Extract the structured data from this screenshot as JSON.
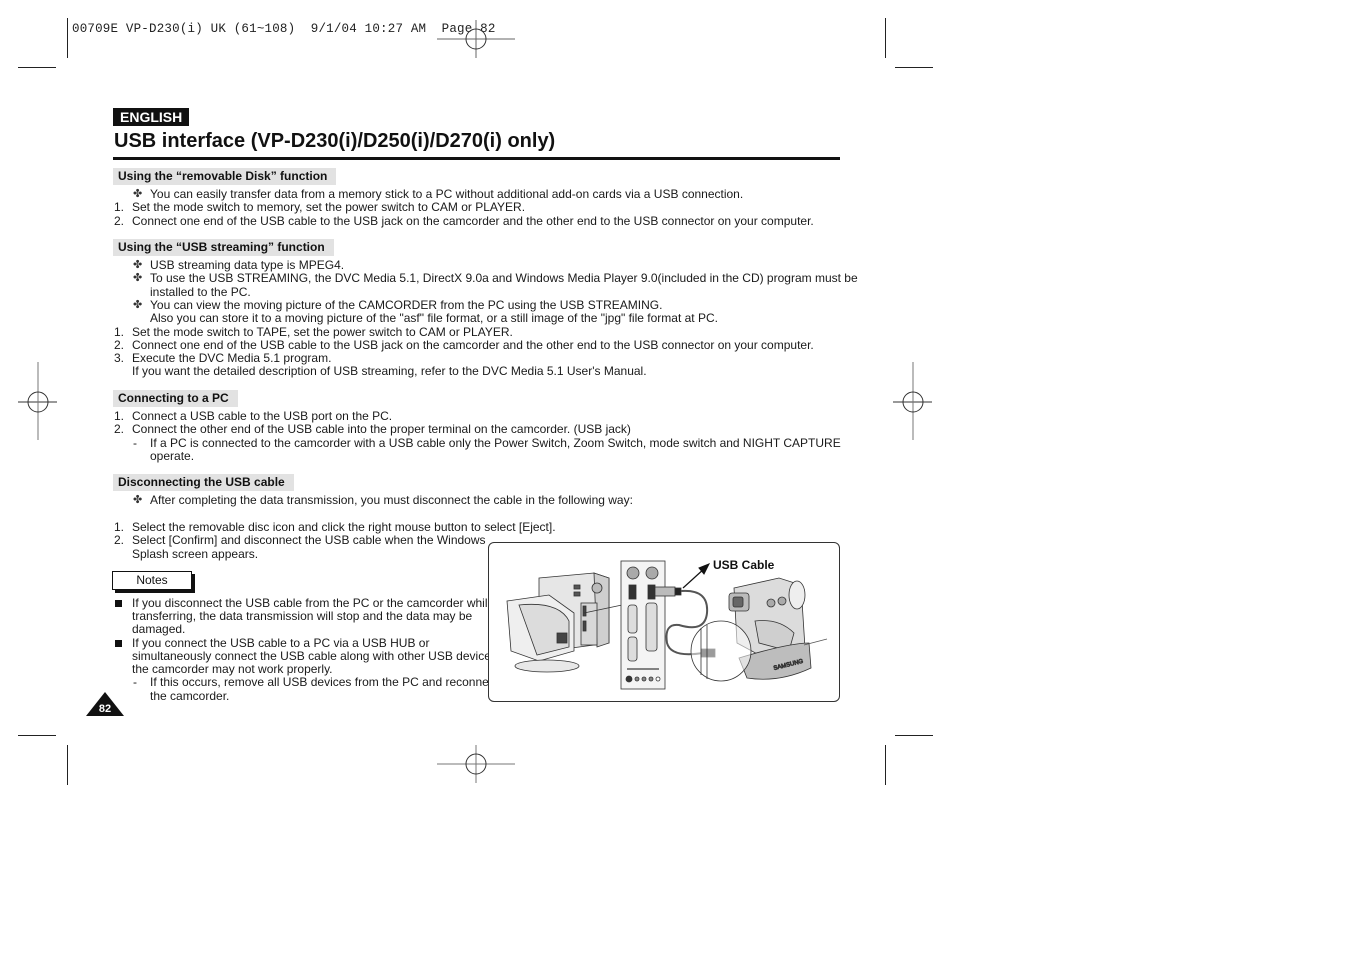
{
  "slug": "00709E VP-D230(i) UK (61~108)  9/1/04 10:27 AM  Page 82",
  "language_badge": "ENGLISH",
  "title": "USB interface (VP-D230(i)/D250(i)/D270(i) only)",
  "sections": {
    "removable": {
      "heading": "Using the “removable Disk” function",
      "bullet": "You can easily transfer data from a memory stick to a PC without additional add-on cards via a USB connection.",
      "steps": [
        {
          "n": "1.",
          "text": "Set the mode switch to memory, set the power switch to CAM or PLAYER."
        },
        {
          "n": "2.",
          "text": "Connect one end of the USB cable to the USB jack on the camcorder and the other end to the USB connector on your computer."
        }
      ]
    },
    "streaming": {
      "heading": "Using the “USB streaming” function",
      "bullets": [
        {
          "lines": [
            "USB streaming data type is MPEG4."
          ]
        },
        {
          "lines": [
            "To use the USB STREAMING, the DVC Media 5.1, DirectX 9.0a and Windows Media Player 9.0(included in the CD) program must be",
            "installed to the PC."
          ]
        },
        {
          "lines": [
            "You can view the moving picture of the CAMCORDER  from the PC using the USB STREAMING.",
            "Also you can store it to a moving picture of the \"asf\" file format, or a still image of the \"jpg\" file format at PC."
          ]
        }
      ],
      "steps": [
        {
          "n": "1.",
          "text": "Set the mode switch to TAPE, set the power switch to CAM or PLAYER."
        },
        {
          "n": "2.",
          "text": "Connect one end of the USB cable to the USB jack on the camcorder and the other end to the USB connector on your computer."
        },
        {
          "n": "3.",
          "text": "Execute the DVC Media 5.1 program."
        }
      ],
      "step3_continuation": "If you want the detailed description of USB streaming, refer to the DVC Media 5.1 User's Manual."
    },
    "connecting": {
      "heading": "Connecting to a PC",
      "steps": [
        {
          "n": "1.",
          "text": "Connect a USB cable to the USB port on the PC."
        },
        {
          "n": "2.",
          "text": "Connect the other end of the USB cable into the proper terminal on the camcorder. (USB jack)"
        }
      ],
      "sub": [
        "If a PC is connected to the camcorder with a USB cable only the Power Switch, Zoom Switch, mode switch and NIGHT CAPTURE",
        "operate."
      ]
    },
    "disconnecting": {
      "heading": "Disconnecting the USB cable",
      "bullet": "After completing the data transmission, you must disconnect the cable in the following way:",
      "steps": [
        {
          "n": "1.",
          "lines": [
            "Select the removable disc icon and click the right mouse button to select [Eject]."
          ]
        },
        {
          "n": "2.",
          "lines": [
            "Select [Confirm] and disconnect the USB cable when the Windows",
            "Splash screen appears."
          ]
        }
      ]
    }
  },
  "notes": {
    "label": "Notes",
    "items": [
      {
        "lines": [
          "If you disconnect the USB cable from the PC or the camcorder while",
          "transferring, the data transmission will stop and the data may be",
          "damaged."
        ]
      },
      {
        "lines": [
          "If you connect the USB cable to a PC via a USB HUB or",
          "simultaneously connect the USB cable along with other USB devices,",
          "the camcorder may not work properly."
        ]
      }
    ],
    "sub": [
      "If this occurs, remove all USB devices from the PC and reconnect",
      "the camcorder."
    ]
  },
  "figure": {
    "label": "USB Cable",
    "brand_on_strap": "SAMSUNG"
  },
  "bullet_glyph": "✤",
  "dash_glyph": "-",
  "page_number": "82"
}
